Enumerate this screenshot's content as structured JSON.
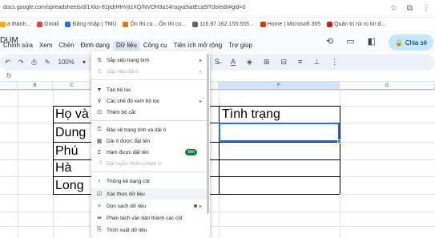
{
  "browser": {
    "url": "docs.google.com/spreadsheets/d/1Xko-81jtdrHHVjIzXQ/NVOH3a14rsqya5iatEca5iTdo/edit#gid=0"
  },
  "bookmarks": [
    {
      "label": "a thành...",
      "color": "#f9ab00"
    },
    {
      "label": "Gmail",
      "color": "#ea4335"
    },
    {
      "label": "Đăng nhập | TMU",
      "color": "#1a73e8"
    },
    {
      "label": "Ôn thi cu... Ôn thi cu...",
      "color": "#e37400"
    },
    {
      "label": "116.97.162.155:555...",
      "color": "#5f6368"
    },
    {
      "label": "Home | Microsoft 365",
      "color": "#d83b01"
    },
    {
      "label": "Quản trị rủi ro tín d...",
      "color": "#c5221f"
    }
  ],
  "sheets": {
    "title_fragment": "DUM",
    "menus": [
      "Chỉnh sửa",
      "Xem",
      "Chèn",
      "Định dạng",
      "Dữ liệu",
      "Công cụ",
      "Tiện ích mở rộng",
      "Trợ giúp"
    ],
    "active_menu": "Dữ liệu",
    "share_label": "Chia sẻ",
    "zoom": "100%",
    "fx": "fx"
  },
  "grid": {
    "columns": [
      "",
      "B",
      "C",
      "D",
      "E",
      "F",
      "G"
    ],
    "cells": {
      "c1": "Họ và",
      "c2": "Dung",
      "c3": "Phú",
      "c4": "Hà",
      "c5": "Long",
      "f1": "Tình trạng"
    }
  },
  "data_menu": {
    "items": [
      {
        "label": "Sắp xếp trang tính",
        "icon": "sort",
        "disabled": false,
        "arrow": true
      },
      {
        "label": "Sắp xếp dải ô",
        "icon": "sort",
        "disabled": true,
        "arrow": true
      },
      {
        "label": "Tạo bộ lọc",
        "icon": "filter",
        "disabled": false
      },
      {
        "label": "Các chế độ xem bộ lọc",
        "icon": "filter-views",
        "disabled": false,
        "arrow": true
      },
      {
        "label": "Thêm bộ cắt",
        "icon": "slicer",
        "disabled": false
      },
      {
        "label": "Bảo vệ trang tính và dải ô",
        "icon": "lock",
        "disabled": false
      },
      {
        "label": "Dải ô được đặt tên",
        "icon": "named-range",
        "disabled": false
      },
      {
        "label": "Hàm được đặt tên",
        "icon": "function",
        "disabled": false,
        "badge": "Mới"
      },
      {
        "label": "Đặt ngẫu nhiên phạm vi",
        "icon": "shuffle",
        "disabled": true
      },
      {
        "label": "Thống kê dạng cột",
        "icon": "lightbulb",
        "disabled": false
      },
      {
        "label": "Xác thực dữ liệu",
        "icon": "validation",
        "disabled": false,
        "highlight": true
      },
      {
        "label": "Dọn sạch dữ liệu",
        "icon": "cleanup",
        "disabled": false,
        "dot": true,
        "arrow": true
      },
      {
        "label": "Phân tách văn bản thành các cột",
        "icon": "split",
        "disabled": false
      },
      {
        "label": "Trích xuất dữ liệu",
        "icon": "extract",
        "disabled": false
      }
    ]
  },
  "colors": {
    "accent": "#1a73e8",
    "new_badge": "#188038",
    "share_bg": "#c2e7ff"
  }
}
